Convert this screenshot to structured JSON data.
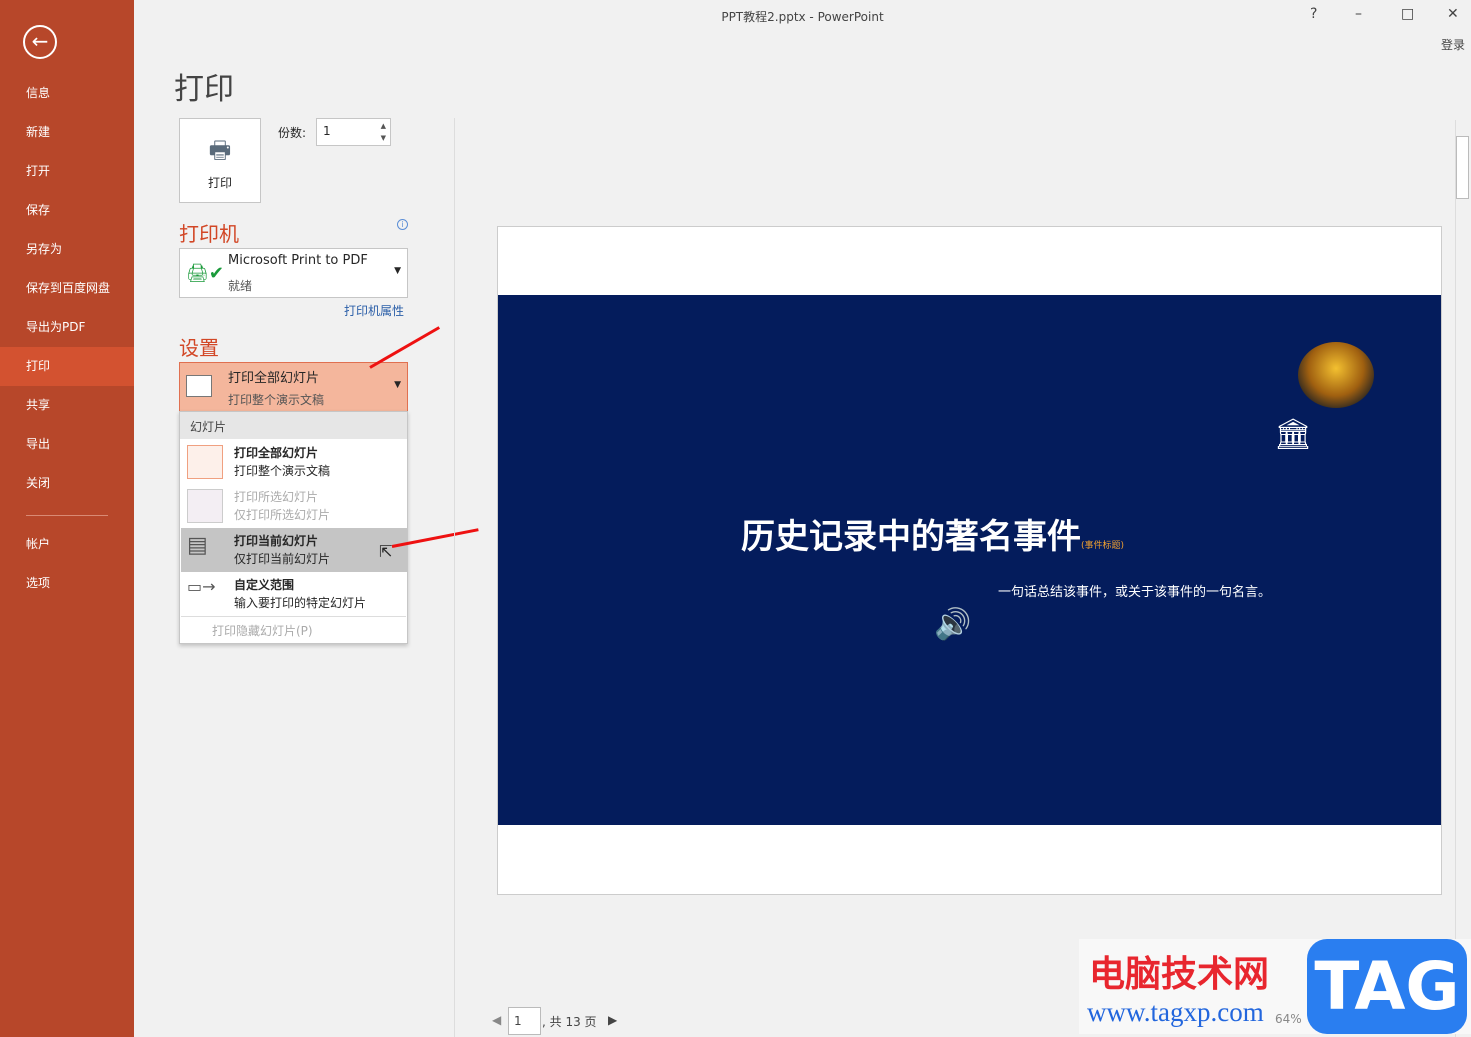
{
  "window": {
    "title": "PPT教程2.pptx - PowerPoint",
    "help": "?",
    "minimize": "–",
    "maximize": "□",
    "close": "✕",
    "login": "登录"
  },
  "sidebar": {
    "back": "←",
    "items": [
      {
        "label": "信息"
      },
      {
        "label": "新建"
      },
      {
        "label": "打开"
      },
      {
        "label": "保存"
      },
      {
        "label": "另存为"
      },
      {
        "label": "保存到百度网盘"
      },
      {
        "label": "导出为PDF"
      },
      {
        "label": "打印"
      },
      {
        "label": "共享"
      },
      {
        "label": "导出"
      },
      {
        "label": "关闭"
      }
    ],
    "bottom": [
      {
        "label": "帐户"
      },
      {
        "label": "选项"
      }
    ]
  },
  "print": {
    "title": "打印",
    "button": "打印",
    "copies_label": "份数:",
    "copies_value": "1"
  },
  "printer": {
    "heading": "打印机",
    "name": "Microsoft Print to PDF",
    "status": "就绪",
    "properties": "打印机属性"
  },
  "settings": {
    "heading": "设置",
    "selected_title": "打印全部幻灯片",
    "selected_sub": "打印整个演示文稿",
    "menu": {
      "header": "幻灯片",
      "items": [
        {
          "title": "打印全部幻灯片",
          "sub": "打印整个演示文稿"
        },
        {
          "title": "打印所选幻灯片",
          "sub": "仅打印所选幻灯片"
        },
        {
          "title": "打印当前幻灯片",
          "sub": "仅打印当前幻灯片"
        },
        {
          "title": "自定义范围",
          "sub": "输入要打印的特定幻灯片"
        }
      ],
      "hidden": "打印隐藏幻灯片(P)"
    }
  },
  "preview": {
    "title": "历史记录中的著名事件",
    "title_tag": "(事件标题)",
    "subtitle": "一句话总结该事件，或关于该事件的一句名言。",
    "page": "1",
    "total": ", 共 13 页",
    "zoom": "64%"
  },
  "watermark": {
    "cn": "电脑技术网",
    "url": "www.tagxp.com",
    "tag": "TAG"
  }
}
